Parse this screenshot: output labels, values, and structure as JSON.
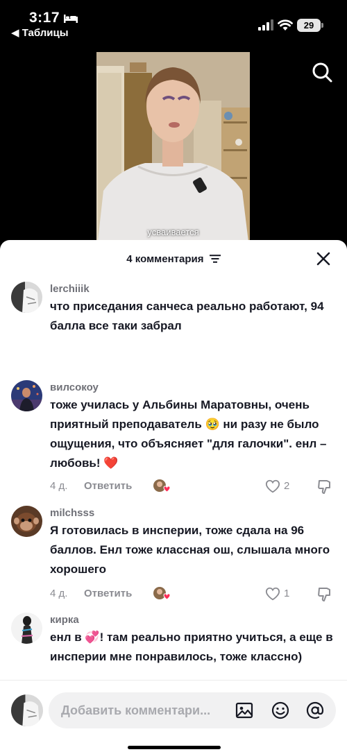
{
  "status_bar": {
    "time": "3:17",
    "back_app": "◀ Таблицы",
    "battery": "29"
  },
  "video": {
    "caption": "усваивается"
  },
  "sheet": {
    "title": "4 комментария"
  },
  "comments": [
    {
      "username": "lerchiiik",
      "text": "что приседания санчеса реально работают, 94 балла все таки забрал"
    },
    {
      "username": "вилсокоу",
      "text": "тоже училась у Альбины Маратовны, очень приятный преподаватель 🥹 ни разу не было ощущения, что объясняет \"для галочки\". енл – любовь! ❤️",
      "age": "4 д.",
      "reply": "Ответить",
      "likes": "2"
    },
    {
      "username": "milchsss",
      "text": "Я готовилась в инсперии, тоже сдала на 96 баллов. Енл тоже классная ош, слышала много хорошего",
      "age": "4 д.",
      "reply": "Ответить",
      "likes": "1"
    },
    {
      "username": "кирка",
      "text": "енл в 💞! там реально приятно учиться, а еще в инсперии мне понравилось, тоже классно)"
    }
  ],
  "composer": {
    "placeholder": "Добавить комментари..."
  },
  "colors": {
    "like_heart": "#fe2c55",
    "text": "#161823",
    "muted": "#8a8b91"
  }
}
